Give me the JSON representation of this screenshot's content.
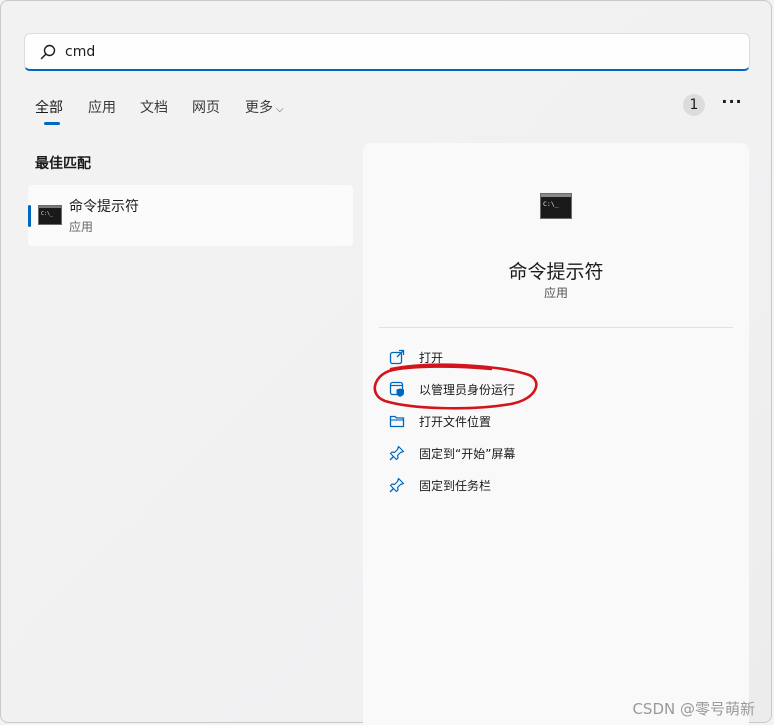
{
  "search": {
    "value": "cmd",
    "icon": "search-icon"
  },
  "tabs": [
    {
      "label": "全部"
    },
    {
      "label": "应用"
    },
    {
      "label": "文档"
    },
    {
      "label": "网页"
    },
    {
      "label": "更多"
    }
  ],
  "header": {
    "badge": "1",
    "more": "···"
  },
  "best_match": {
    "title": "最佳匹配",
    "item": {
      "name": "命令提示符",
      "type": "应用",
      "icon": "command-prompt-icon"
    }
  },
  "details": {
    "name": "命令提示符",
    "type": "应用",
    "actions": [
      {
        "label": "打开",
        "icon": "open-external-icon"
      },
      {
        "label": "以管理员身份运行",
        "icon": "shield-admin-icon"
      },
      {
        "label": "打开文件位置",
        "icon": "folder-icon"
      },
      {
        "label": "固定到“开始”屏幕",
        "icon": "pin-icon"
      },
      {
        "label": "固定到任务栏",
        "icon": "pin-icon"
      }
    ]
  },
  "colors": {
    "accent": "#0067c0",
    "annotation": "#d4141c"
  },
  "watermark": "CSDN @零号萌新"
}
